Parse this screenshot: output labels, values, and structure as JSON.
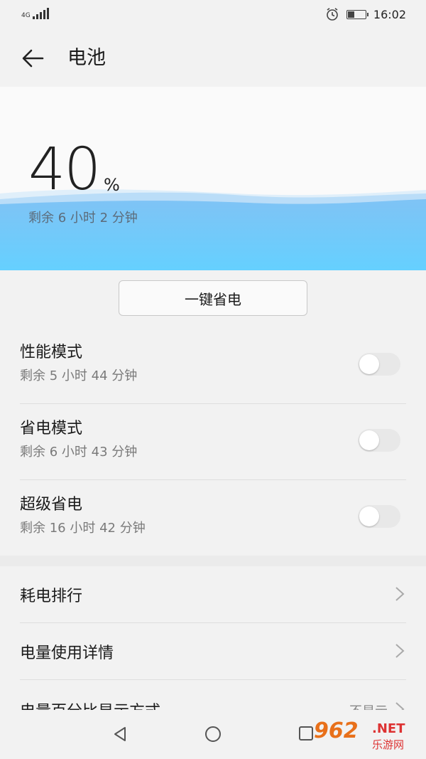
{
  "status_bar": {
    "network": "4G",
    "time": "16:02",
    "battery_level": 0.4,
    "icons": [
      "signal-icon",
      "alarm-icon",
      "battery-icon"
    ]
  },
  "header": {
    "title": "电池",
    "back_icon": "arrow-left-icon"
  },
  "battery": {
    "percent": "40",
    "unit": "%",
    "remaining": "剩余 6 小时 2 分钟"
  },
  "one_key_button": "一键省电",
  "modes": [
    {
      "title": "性能模式",
      "remaining": "剩余 5 小时 44 分钟",
      "enabled": false
    },
    {
      "title": "省电模式",
      "remaining": "剩余 6 小时 43 分钟",
      "enabled": false
    },
    {
      "title": "超级省电",
      "remaining": "剩余 16 小时 42 分钟",
      "enabled": false
    }
  ],
  "menu": [
    {
      "label": "耗电排行",
      "value": ""
    },
    {
      "label": "电量使用详情",
      "value": ""
    },
    {
      "label": "电量百分比显示方式",
      "value": "不显示"
    }
  ],
  "watermark": {
    "main": "962",
    "net": ".NET",
    "sub": "乐游网"
  },
  "colors": {
    "wave_top": "#7fc3f5",
    "wave_bottom": "#65d0ff",
    "watermark_orange": "#e8701a",
    "watermark_red": "#dd3333"
  }
}
